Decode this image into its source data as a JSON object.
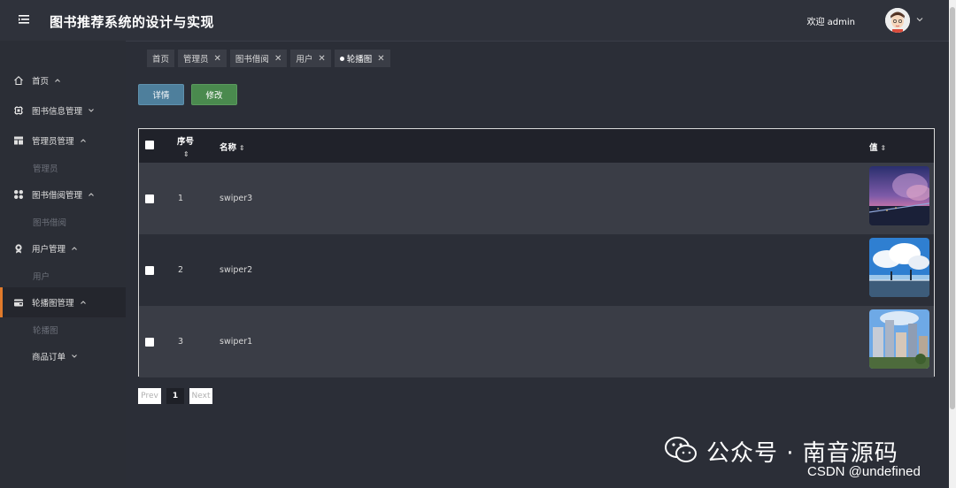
{
  "header": {
    "title": "图书推荐系统的设计与实现",
    "welcome": "欢迎 admin"
  },
  "sidebar": {
    "items": [
      {
        "label": "首页",
        "icon": "home-icon",
        "chevron": "up"
      },
      {
        "label": "图书信息管理",
        "icon": "chip-icon",
        "chevron": "down"
      },
      {
        "label": "管理员管理",
        "icon": "layout-icon",
        "chevron": "up",
        "sub": "管理员"
      },
      {
        "label": "图书借阅管理",
        "icon": "grid-icon",
        "chevron": "up",
        "sub": "图书借阅"
      },
      {
        "label": "用户管理",
        "icon": "user-badge-icon",
        "chevron": "up",
        "sub": "用户"
      },
      {
        "label": "轮播图管理",
        "icon": "wallet-icon",
        "chevron": "up",
        "sub": "轮播图",
        "active": true
      },
      {
        "label": "商品订单",
        "icon": "",
        "chevron": "down"
      }
    ]
  },
  "tabs": [
    {
      "label": "首页",
      "closable": false
    },
    {
      "label": "管理员",
      "closable": true
    },
    {
      "label": "图书借阅",
      "closable": true
    },
    {
      "label": "用户",
      "closable": true
    },
    {
      "label": "轮播图",
      "closable": true,
      "active": true
    }
  ],
  "toolbar": {
    "detail_label": "详情",
    "edit_label": "修改"
  },
  "table": {
    "columns": [
      "序号",
      "名称",
      "值"
    ],
    "rows": [
      {
        "index": "1",
        "name": "swiper3",
        "image": "night-sky-city-image"
      },
      {
        "index": "2",
        "name": "swiper2",
        "image": "cloudy-bridge-image"
      },
      {
        "index": "3",
        "name": "swiper1",
        "image": "city-buildings-image"
      }
    ]
  },
  "pagination": {
    "prev": "Prev",
    "current": "1",
    "next": "Next"
  },
  "watermark": {
    "wechat": "公众号 · 南音源码",
    "csdn": "CSDN @undefined"
  },
  "colors": {
    "background": "#2b2e37",
    "header": "#2f323b",
    "active_accent": "#e07a2b",
    "detail_button": "#4e7f9c",
    "edit_button": "#4a8a4e"
  }
}
